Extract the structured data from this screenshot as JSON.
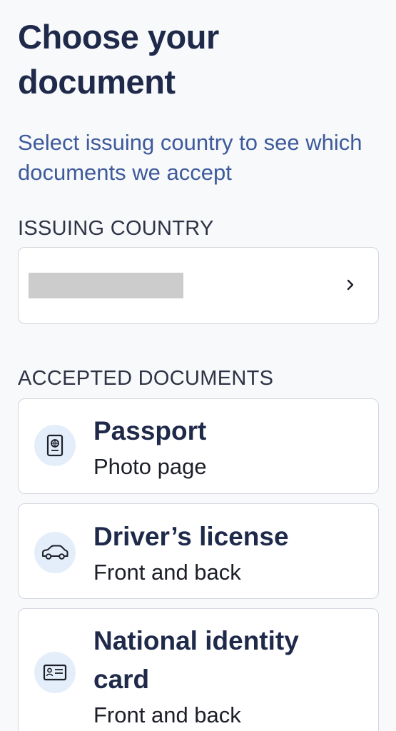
{
  "header": {
    "title": "Choose your document",
    "subtitle": "Select issuing country to see which documents we accept"
  },
  "country": {
    "label": "ISSUING COUNTRY",
    "value_redacted": true,
    "chevron_icon": "chevron-right-icon"
  },
  "documents": {
    "label": "ACCEPTED DOCUMENTS",
    "items": [
      {
        "name": "Passport",
        "description": "Photo page",
        "icon": "passport-icon"
      },
      {
        "name": "Driver’s license",
        "description": "Front and back",
        "icon": "car-icon"
      },
      {
        "name": "National identity card",
        "description": "Front and back",
        "icon": "id-card-icon"
      }
    ]
  },
  "colors": {
    "title": "#1f2a4b",
    "subtitle": "#3d5a9b",
    "icon_bg": "#e4eefb",
    "card_border": "#d3d6dd",
    "background": "#f8f9fb"
  }
}
